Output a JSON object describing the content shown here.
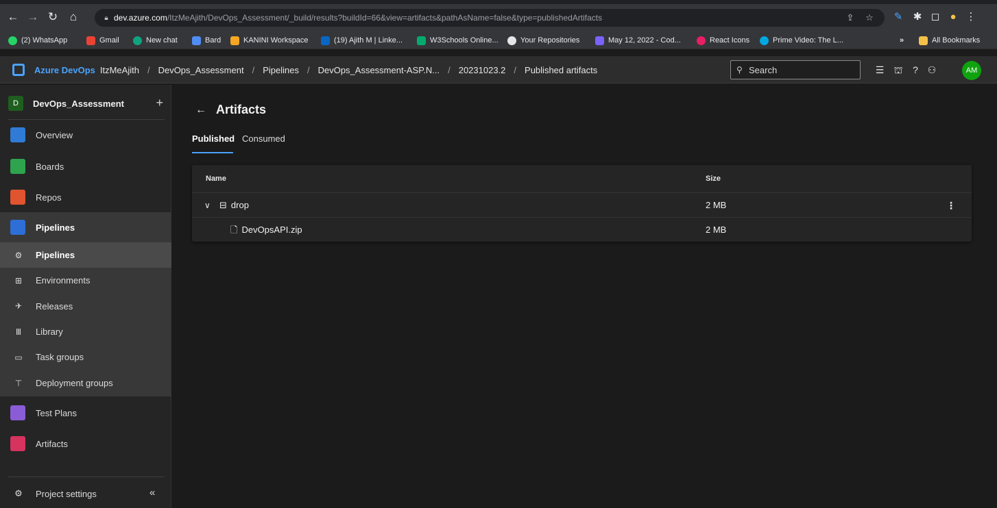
{
  "browser": {
    "url_host": "dev.azure.com",
    "url_path": "/ItzMeAjith/DevOps_Assessment/_build/results?buildId=66&view=artifacts&pathAsName=false&type=publishedArtifacts",
    "bookmarks": [
      {
        "label": "(2) WhatsApp",
        "color": "#25d366"
      },
      {
        "label": "Gmail",
        "color": "#ea4335"
      },
      {
        "label": "New chat",
        "color": "#10a37f"
      },
      {
        "label": "Bard",
        "color": "#4f8df5"
      },
      {
        "label": "KANINI Workspace",
        "color": "#f5a623"
      },
      {
        "label": "(19) Ajith M | Linke...",
        "color": "#0a66c2"
      },
      {
        "label": "W3Schools Online...",
        "color": "#04aa6d"
      },
      {
        "label": "Your Repositories",
        "color": "#e6e6e6"
      },
      {
        "label": "May 12, 2022 - Cod...",
        "color": "#7b61ff"
      },
      {
        "label": "React Icons",
        "color": "#e91e63"
      },
      {
        "label": "Prime Video: The L...",
        "color": "#00a8e1"
      }
    ],
    "bookmarks_overflow": "»",
    "all_bookmarks": "All Bookmarks"
  },
  "header": {
    "brand": "Azure DevOps",
    "breadcrumbs": [
      "ItzMeAjith",
      "DevOps_Assessment",
      "Pipelines",
      "DevOps_Assessment-ASP.N...",
      "20231023.2",
      "Published artifacts"
    ],
    "search_placeholder": "Search",
    "avatar": "AM"
  },
  "nav": {
    "project_initial": "D",
    "project_name": "DevOps_Assessment",
    "add": "+",
    "items": [
      {
        "label": "Overview",
        "color": "#2f7bd6"
      },
      {
        "label": "Boards",
        "color": "#2ea44f"
      },
      {
        "label": "Repos",
        "color": "#e0542f"
      },
      {
        "label": "Pipelines",
        "color": "#2d6fd6"
      }
    ],
    "sub_items": [
      {
        "label": "Pipelines",
        "icon": "⚙"
      },
      {
        "label": "Environments",
        "icon": "⊞"
      },
      {
        "label": "Releases",
        "icon": "✈"
      },
      {
        "label": "Library",
        "icon": "Ⅲ"
      },
      {
        "label": "Task groups",
        "icon": "▭"
      },
      {
        "label": "Deployment groups",
        "icon": "⊤"
      }
    ],
    "bottom_items": [
      {
        "label": "Test Plans",
        "color": "#8a5cd6"
      },
      {
        "label": "Artifacts",
        "color": "#d6335e"
      }
    ],
    "settings": "Project settings",
    "collapse": "«"
  },
  "main": {
    "title": "Artifacts",
    "tabs": [
      "Published",
      "Consumed"
    ],
    "table": {
      "columns": [
        "Name",
        "Size"
      ],
      "rows": [
        {
          "name": "drop",
          "size": "2 MB",
          "type": "folder"
        },
        {
          "name": "DevOpsAPI.zip",
          "size": "2 MB",
          "type": "file"
        }
      ]
    }
  }
}
